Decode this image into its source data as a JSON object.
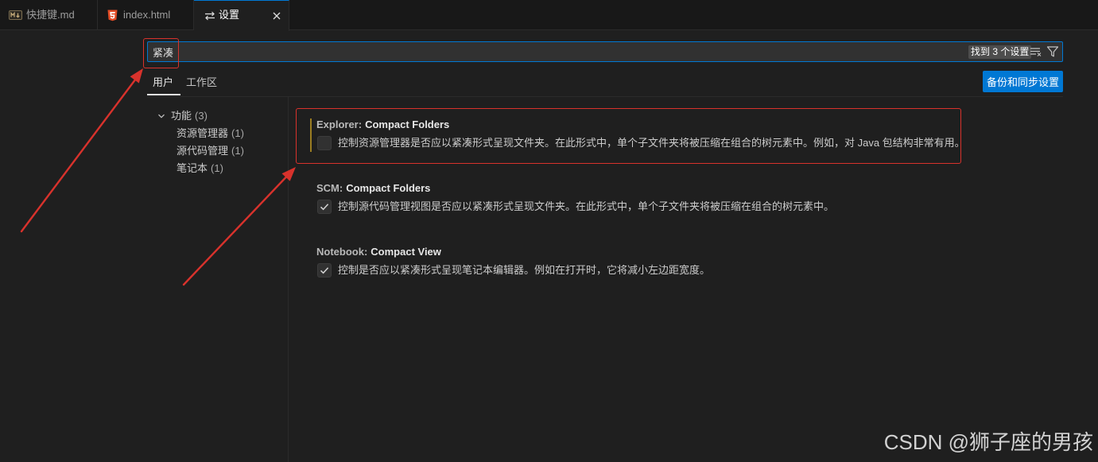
{
  "window": {
    "tabs": [
      {
        "label": "快捷键.md",
        "icon": "markdown-icon",
        "active": false
      },
      {
        "label": "index.html",
        "icon": "html5-icon",
        "active": false
      },
      {
        "label": "设置",
        "icon": "settings-editor-icon",
        "active": true,
        "close_icon": "close-icon"
      }
    ]
  },
  "search": {
    "value": "紧凑",
    "results_badge": "找到 3 个设置",
    "clear_icon": "clear-filter-icon",
    "filter_icon": "filter-icon"
  },
  "scope_tabs": [
    {
      "label": "用户",
      "active": true
    },
    {
      "label": "工作区",
      "active": false
    }
  ],
  "backup_sync_button": {
    "label": "备份和同步设置"
  },
  "toc": {
    "group": {
      "label": "功能",
      "count": "(3)",
      "expanded": true,
      "icon": "chevron-down-icon"
    },
    "items": [
      {
        "label": "资源管理器",
        "count": "(1)"
      },
      {
        "label": "源代码管理",
        "count": "(1)"
      },
      {
        "label": "笔记本",
        "count": "(1)"
      }
    ]
  },
  "settings": [
    {
      "category": "Explorer:",
      "name": "Compact Folders",
      "description": "控制资源管理器是否应以紧凑形式呈现文件夹。在此形式中，单个子文件夹将被压缩在组合的树元素中。例如，对 Java 包结构非常有用。",
      "checked": false,
      "focused": true
    },
    {
      "category": "SCM:",
      "name": "Compact Folders",
      "description": "控制源代码管理视图是否应以紧凑形式呈现文件夹。在此形式中，单个子文件夹将被压缩在组合的树元素中。",
      "checked": true,
      "focused": false
    },
    {
      "category": "Notebook:",
      "name": "Compact View",
      "description": "控制是否应以紧凑形式呈现笔记本编辑器。例如在打开时，它将减小左边距宽度。",
      "checked": true,
      "focused": false
    }
  ],
  "watermark": "CSDN @狮子座的男孩",
  "colors": {
    "background": "#1f1f1f",
    "accent": "#0078d4",
    "annotation": "#d8322c",
    "html5_orange": "#e44d26",
    "focus_indicator": "#9b7d22"
  }
}
